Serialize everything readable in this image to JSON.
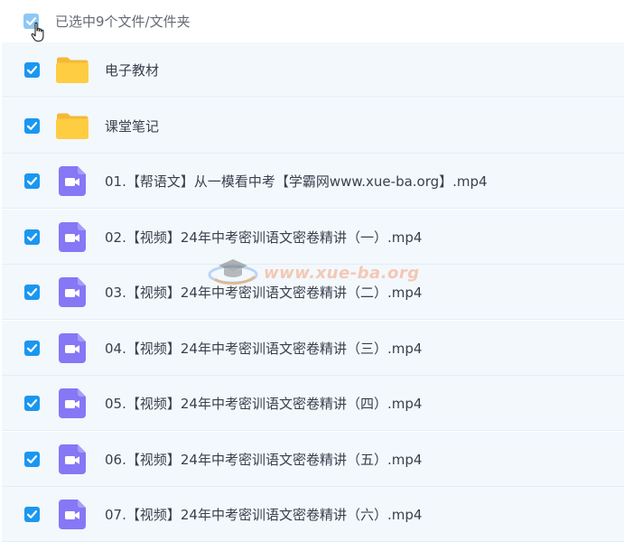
{
  "header": {
    "selection_text": "已选中9个文件/文件夹",
    "select_all_checked": true
  },
  "rows": [
    {
      "type": "folder",
      "name": "电子教材",
      "checked": true
    },
    {
      "type": "folder",
      "name": "课堂笔记",
      "checked": true
    },
    {
      "type": "video",
      "name": "01.【帮语文】从一模看中考【学霸网www.xue-ba.org】.mp4",
      "checked": true
    },
    {
      "type": "video",
      "name": "02.【视频】24年中考密训语文密卷精讲（一）.mp4",
      "checked": true
    },
    {
      "type": "video",
      "name": "03.【视频】24年中考密训语文密卷精讲（二）.mp4",
      "checked": true
    },
    {
      "type": "video",
      "name": "04.【视频】24年中考密训语文密卷精讲（三）.mp4",
      "checked": true
    },
    {
      "type": "video",
      "name": "05.【视频】24年中考密训语文密卷精讲（四）.mp4",
      "checked": true
    },
    {
      "type": "video",
      "name": "06.【视频】24年中考密训语文密卷精讲（五）.mp4",
      "checked": true
    },
    {
      "type": "video",
      "name": "07.【视频】24年中考密训语文密卷精讲（六）.mp4",
      "checked": true
    }
  ],
  "watermark": {
    "text": "www.xue-ba.org"
  },
  "colors": {
    "checkbox": "#1a97f0",
    "folder": "#ffcd42",
    "video": "#8677f5",
    "row_background": "#f3f8fd"
  },
  "icons": {
    "folder": "folder-icon",
    "video": "video-file-icon",
    "check": "checkmark-icon",
    "cursor": "hand-pointer-icon"
  }
}
